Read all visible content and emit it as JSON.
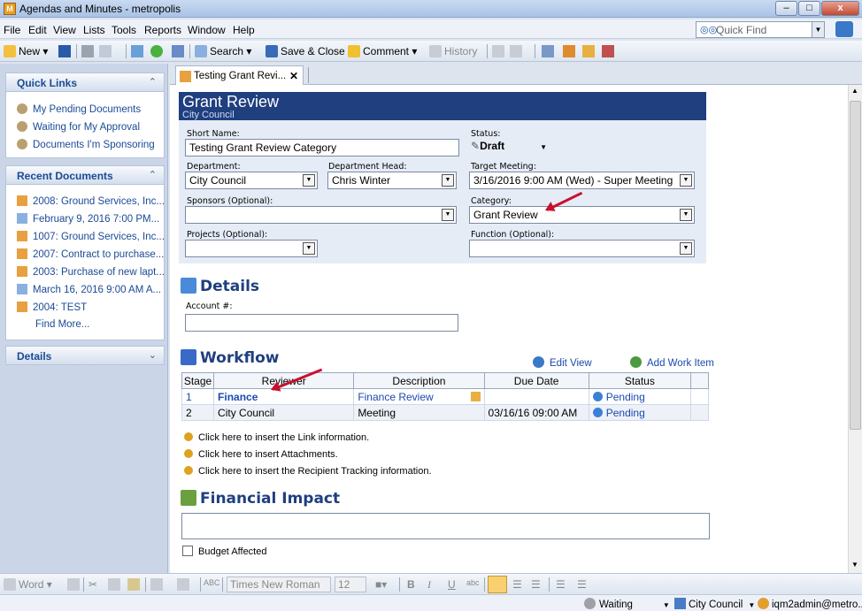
{
  "window": {
    "title": "Agendas and Minutes - metropolis"
  },
  "menu": [
    "File",
    "Edit",
    "View",
    "Lists",
    "Tools",
    "Reports",
    "Window",
    "Help"
  ],
  "quickfind": {
    "placeholder": "Quick Find"
  },
  "toolbar": {
    "new": "New",
    "search": "Search",
    "save_close": "Save & Close",
    "comment": "Comment",
    "history": "History"
  },
  "sidebar": {
    "quick_links": {
      "title": "Quick Links",
      "items": [
        "My Pending Documents",
        "Waiting for My Approval",
        "Documents I'm Sponsoring"
      ]
    },
    "recent": {
      "title": "Recent Documents",
      "items": [
        "2008: Ground Services, Inc...",
        "February 9, 2016 7:00 PM...",
        "1007: Ground Services, Inc...",
        "2007: Contract to purchase...",
        "2003: Purchase of new lapt...",
        "March 16, 2016 9:00 AM A...",
        "2004: TEST"
      ],
      "find_more": "Find More..."
    },
    "details": {
      "title": "Details"
    }
  },
  "tab": {
    "label": "Testing Grant Revi..."
  },
  "form": {
    "title": "Grant Review",
    "subtitle": "City Council",
    "short_name_label": "Short Name:",
    "short_name": "Testing Grant Review Category",
    "status_label": "Status:",
    "status": "Draft",
    "department_label": "Department:",
    "department": "City Council",
    "dept_head_label": "Department Head:",
    "dept_head": "Chris Winter",
    "target_meeting_label": "Target Meeting:",
    "target_meeting": "3/16/2016 9:00 AM (Wed) - Super Meeting",
    "sponsors_label": "Sponsors (Optional):",
    "category_label": "Category:",
    "category": "Grant Review",
    "projects_label": "Projects (Optional):",
    "function_label": "Function (Optional):"
  },
  "details": {
    "title": "Details",
    "account_label": "Account #:"
  },
  "workflow": {
    "title": "Workflow",
    "edit_view": "Edit View",
    "add_item": "Add Work Item",
    "columns": [
      "Stage",
      "Reviewer",
      "Description",
      "Due Date",
      "Status"
    ],
    "rows": [
      {
        "stage": "1",
        "reviewer": "Finance",
        "description": "Finance Review",
        "due": "",
        "status": "Pending"
      },
      {
        "stage": "2",
        "reviewer": "City Council",
        "description": "Meeting",
        "due": "03/16/16 09:00 AM",
        "status": "Pending"
      }
    ]
  },
  "inserts": [
    "Click here to insert the Link information.",
    "Click here to insert Attachments.",
    "Click here to insert the Recipient Tracking information."
  ],
  "financial": {
    "title": "Financial Impact",
    "budget_label": "Budget Affected"
  },
  "format": {
    "word": "Word",
    "font": "Times New Roman",
    "size": "12"
  },
  "status": {
    "waiting": "Waiting",
    "council": "City Council",
    "user": "iqm2admin@metro..."
  }
}
